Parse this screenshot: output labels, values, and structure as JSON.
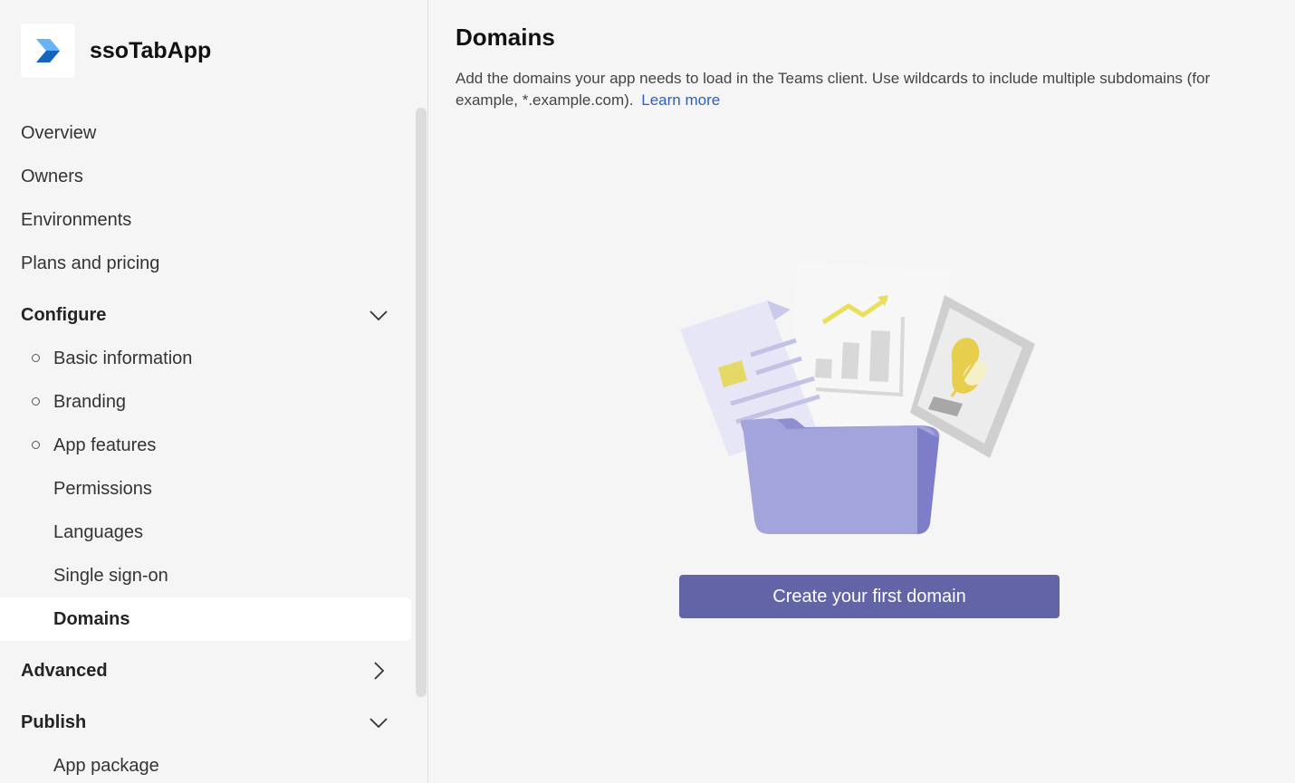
{
  "app": {
    "name": "ssoTabApp",
    "logo_icon": "teams-toolkit-logo-icon"
  },
  "sidebar": {
    "items": [
      {
        "label": "Overview"
      },
      {
        "label": "Owners"
      },
      {
        "label": "Environments"
      },
      {
        "label": "Plans and pricing"
      }
    ],
    "configure": {
      "label": "Configure",
      "expanded": true,
      "items": [
        {
          "label": "Basic information"
        },
        {
          "label": "Branding"
        },
        {
          "label": "App features"
        },
        {
          "label": "Permissions"
        },
        {
          "label": "Languages"
        },
        {
          "label": "Single sign-on"
        },
        {
          "label": "Domains",
          "selected": true
        }
      ]
    },
    "advanced": {
      "label": "Advanced",
      "expanded": false
    },
    "publish": {
      "label": "Publish",
      "expanded": true,
      "items": [
        {
          "label": "App package"
        }
      ]
    }
  },
  "main": {
    "title": "Domains",
    "description": "Add the domains your app needs to load in the Teams client. Use wildcards to include multiple subdomains (for example, *.example.com).",
    "learn_more": "Learn more",
    "create_button": "Create your first domain"
  },
  "colors": {
    "accent": "#6264a7",
    "link": "#2d5fbd",
    "background": "#f5f5f5",
    "selected_background": "#ffffff"
  }
}
